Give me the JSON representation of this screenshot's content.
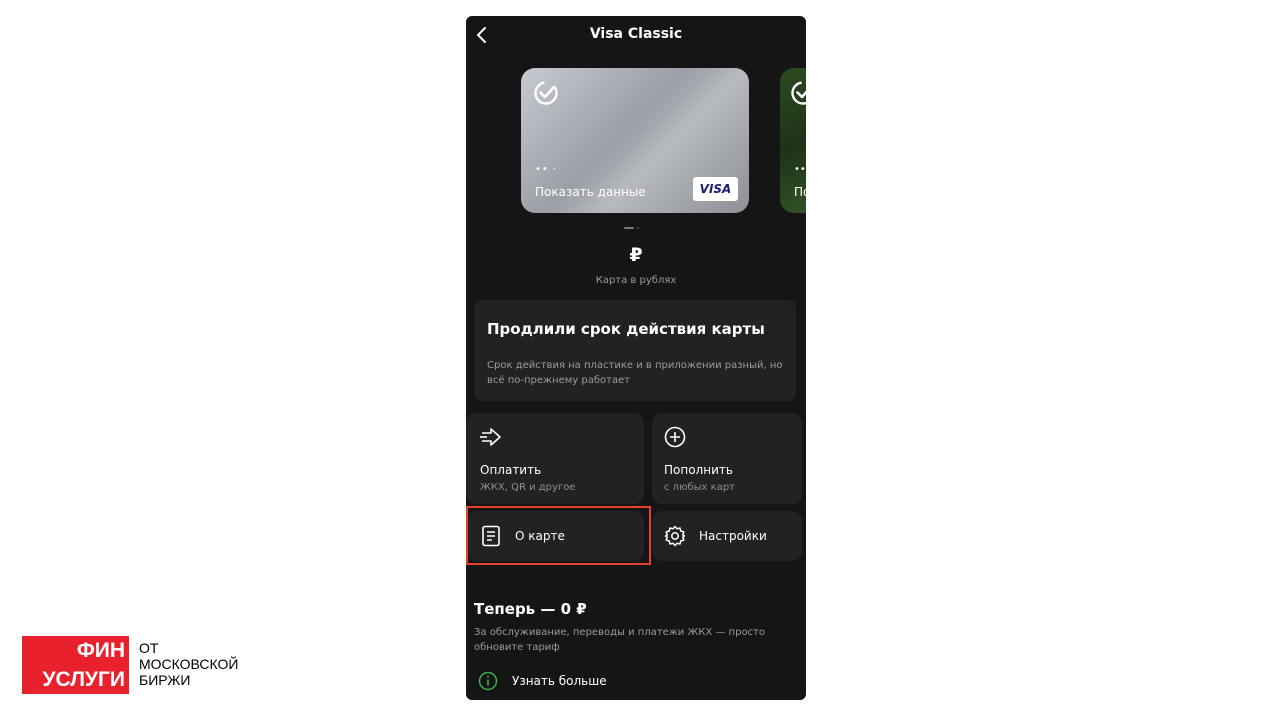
{
  "header": {
    "title": "Visa Classic"
  },
  "card": {
    "dots": "•• ·",
    "show_label": "Показать данные",
    "brand": "VISA"
  },
  "card2": {
    "dots": "••",
    "show_label": "По"
  },
  "currency": {
    "symbol": "₽",
    "label": "Карта в рублях"
  },
  "notice": {
    "title": "Продлили срок действия карты",
    "text": "Срок действия на пластике и в приложении разный, но всё по-прежнему работает"
  },
  "actions": {
    "pay": {
      "title": "Оплатить",
      "sub": "ЖКХ, QR и другое",
      "icon": "send-arrow-icon"
    },
    "topup": {
      "title": "Пополнить",
      "sub": "с любых карт",
      "icon": "plus-circle-icon"
    },
    "about": {
      "title": "О карте",
      "icon": "document-icon"
    },
    "settings": {
      "title": "Настройки",
      "icon": "gear-icon"
    }
  },
  "promo": {
    "title": "Теперь — 0 ₽",
    "text": "За обслуживание, переводы и платежи ЖКХ — просто обновите тариф",
    "learn_more": "Узнать больше"
  },
  "watermark": {
    "line1": "ФИН",
    "line2": "УСЛУГИ",
    "sub1": "ОТ",
    "sub2": "МОСКОВСКОЙ",
    "sub3": "БИРЖИ"
  },
  "colors": {
    "highlight": "#e5412b",
    "info_icon": "#3fae49",
    "logo_red": "#e8212c"
  }
}
